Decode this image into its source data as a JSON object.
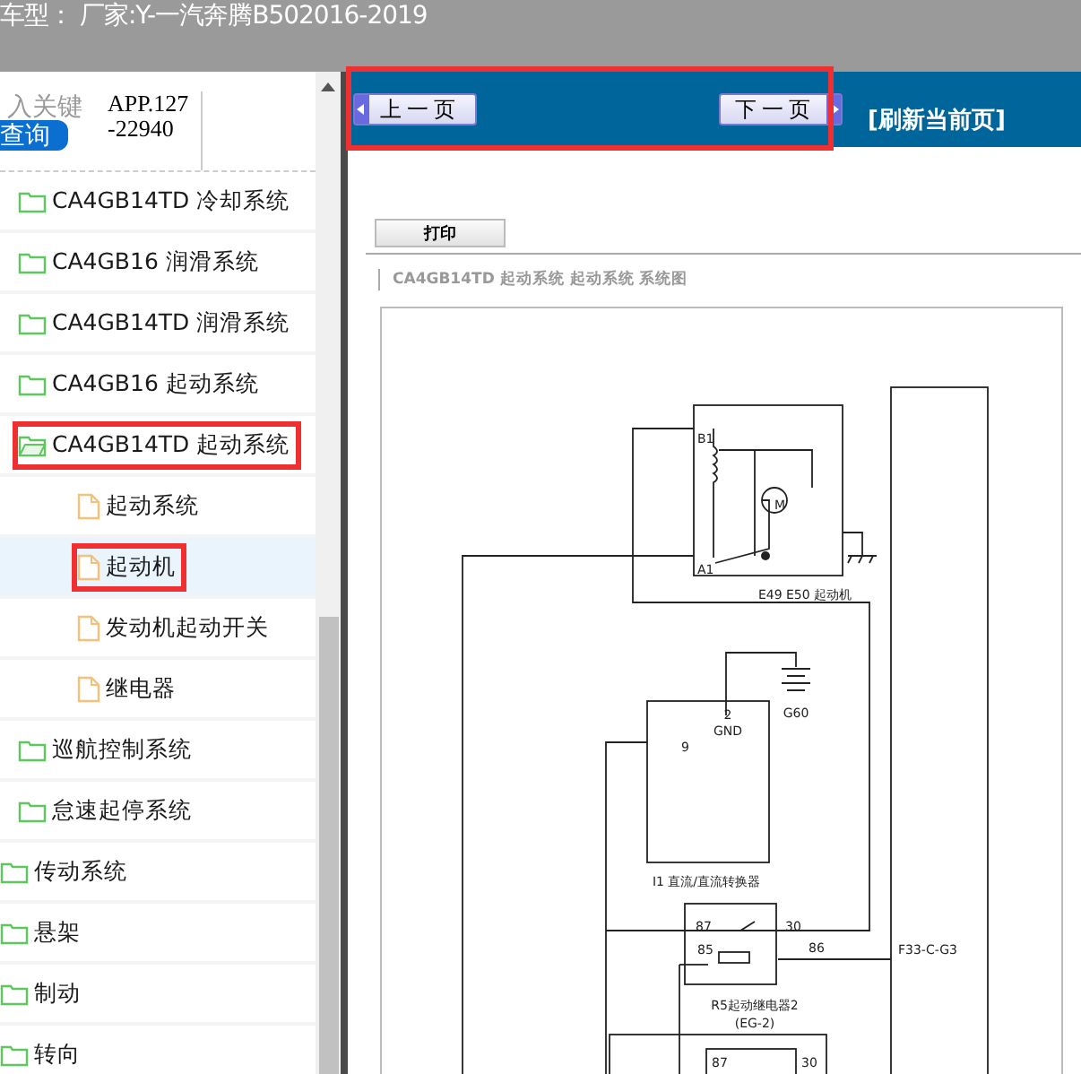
{
  "header": {
    "text": "车型：  厂家:Y-一汽奔腾B502016-2019"
  },
  "search": {
    "placeholder": "入关键",
    "button": "查询",
    "app_code": "APP.127-22940"
  },
  "tree": {
    "items": [
      {
        "label": "CA4GB14TD 冷却系统",
        "kind": "folder",
        "expanded": false,
        "selected": false,
        "highlighted": false
      },
      {
        "label": "CA4GB16 润滑系统",
        "kind": "folder",
        "expanded": false,
        "selected": false,
        "highlighted": false
      },
      {
        "label": "CA4GB14TD 润滑系统",
        "kind": "folder",
        "expanded": false,
        "selected": false,
        "highlighted": false
      },
      {
        "label": "CA4GB16 起动系统",
        "kind": "folder",
        "expanded": false,
        "selected": false,
        "highlighted": false
      },
      {
        "label": "CA4GB14TD 起动系统",
        "kind": "folder",
        "expanded": true,
        "selected": false,
        "highlighted": true,
        "children": [
          {
            "label": "起动系统",
            "kind": "file",
            "selected": false,
            "highlighted": false
          },
          {
            "label": "起动机",
            "kind": "file",
            "selected": true,
            "highlighted": true
          },
          {
            "label": "发动机起动开关",
            "kind": "file",
            "selected": false,
            "highlighted": false
          },
          {
            "label": "继电器",
            "kind": "file",
            "selected": false,
            "highlighted": false
          }
        ]
      },
      {
        "label": "巡航控制系统",
        "kind": "folder",
        "expanded": false,
        "selected": false,
        "highlighted": false
      },
      {
        "label": "怠速起停系统",
        "kind": "folder",
        "expanded": false,
        "selected": false,
        "highlighted": false
      }
    ],
    "top_items": [
      {
        "label": "传动系统",
        "kind": "folder",
        "expanded": false,
        "selected": false,
        "highlighted": false
      },
      {
        "label": "悬架",
        "kind": "folder",
        "expanded": false,
        "selected": false,
        "highlighted": false
      },
      {
        "label": "制动",
        "kind": "folder",
        "expanded": false,
        "selected": false,
        "highlighted": false
      },
      {
        "label": "转向",
        "kind": "folder",
        "expanded": false,
        "selected": false,
        "highlighted": false
      }
    ]
  },
  "nav": {
    "prev": "上一页",
    "next": "下一页",
    "refresh": "[刷新当前页]",
    "highlighted": true
  },
  "document": {
    "print_button": "打印",
    "breadcrumb": "CA4GB14TD 起动系统  起动系统  系统图",
    "diagram_labels": [
      "B1",
      "M",
      "A1",
      "E49 E50 起动机",
      "2",
      "GND",
      "G60",
      "9",
      "I1 直流/直流转换器",
      "87",
      "30",
      "85",
      "86",
      "F33-C-G3",
      "R5起动继电器2",
      "(EG-2)",
      "87",
      "30"
    ]
  }
}
